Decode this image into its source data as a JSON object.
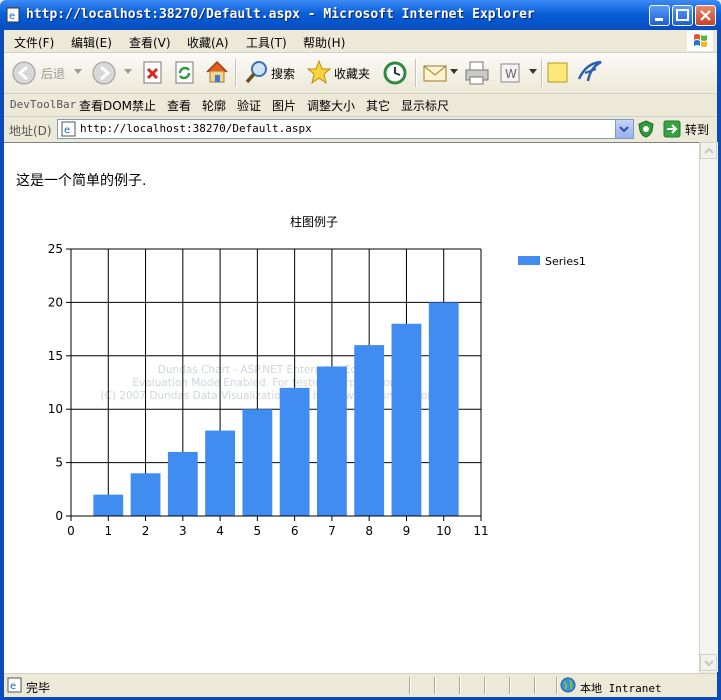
{
  "window": {
    "title": "http://localhost:38270/Default.aspx - Microsoft Internet Explorer"
  },
  "menu": {
    "items": [
      "文件(F)",
      "编辑(E)",
      "查看(V)",
      "收藏(A)",
      "工具(T)",
      "帮助(H)"
    ]
  },
  "toolbar": {
    "back_label": "后退",
    "search_label": "搜索",
    "favorites_label": "收藏夹"
  },
  "devtoolbar": {
    "title": "DevToolBar",
    "items": [
      "查看DOM",
      "禁止",
      "查看",
      "轮廓",
      "验证",
      "图片",
      "调整大小",
      "其它",
      "显示标尺"
    ]
  },
  "address": {
    "label": "地址(D)",
    "url": "http://localhost:38270/Default.aspx",
    "go_label": "转到"
  },
  "page": {
    "intro_text": "这是一个简单的例子."
  },
  "chart_data": {
    "type": "bar",
    "title": "柱图例子",
    "x": [
      1,
      2,
      3,
      4,
      5,
      6,
      7,
      8,
      9,
      10
    ],
    "series": [
      {
        "name": "Series1",
        "values": [
          2,
          4,
          6,
          8,
          10,
          12,
          14,
          16,
          18,
          20
        ],
        "color": "#418cf0"
      }
    ],
    "xlim": [
      0,
      11
    ],
    "ylim": [
      0,
      25
    ],
    "xticks": [
      0,
      1,
      2,
      3,
      4,
      5,
      6,
      7,
      8,
      9,
      10,
      11
    ],
    "yticks": [
      0,
      5,
      10,
      15,
      20,
      25
    ],
    "grid": true,
    "legend": "top-right",
    "watermark": [
      "Dundas Chart - ASP.NET Enterprise Edition",
      "Evaluation Mode Enabled. For testing purposes only",
      "(C) 2007 Dundas Data Visualization Inc. http://www.dundas.com"
    ]
  },
  "status": {
    "left_text": "完毕",
    "zone_text": "本地 Intranet"
  }
}
